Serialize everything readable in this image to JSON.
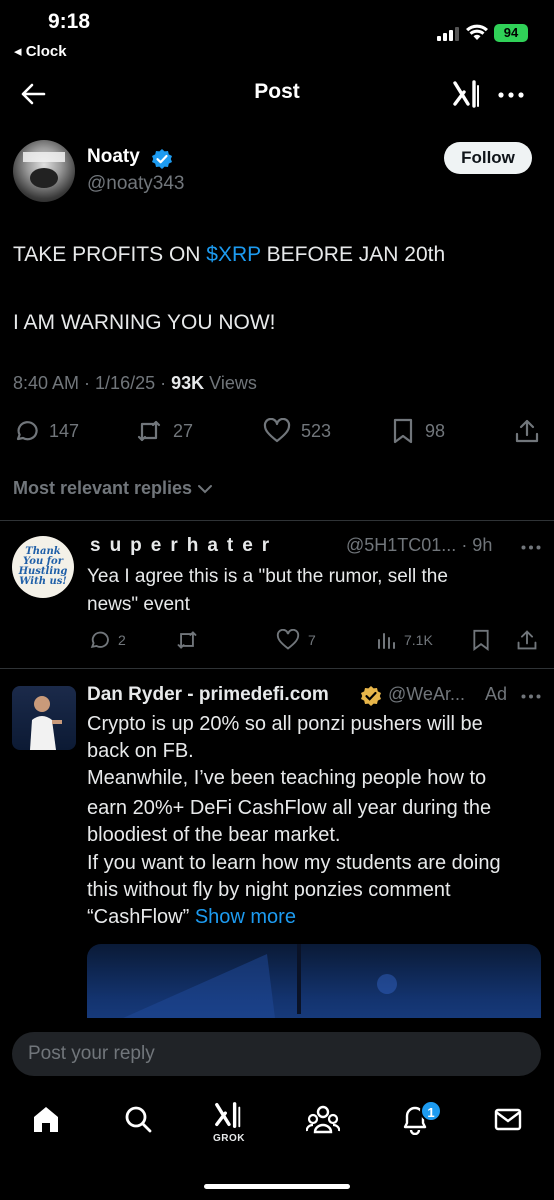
{
  "status_bar": {
    "time": "9:18",
    "back_app": "◂ Clock",
    "battery": "94"
  },
  "header": {
    "title": "Post"
  },
  "post": {
    "author_name": "Noaty",
    "author_handle": "@noaty343",
    "follow_label": "Follow",
    "text_line1_before": "TAKE PROFITS ON ",
    "text_line1_cashtag": "$XRP",
    "text_line1_after": " BEFORE JAN 20th",
    "text_line2": "I AM WARNING YOU NOW!",
    "time": "8:40 AM",
    "date": "1/16/25",
    "views_count": "93K",
    "views_label": "Views",
    "replies": "147",
    "reposts": "27",
    "likes": "523",
    "bookmarks": "98"
  },
  "replies_filter": "Most relevant replies",
  "reply": {
    "avatar_text": "Thank You for Hustling With us!",
    "name": "superhater",
    "handle_time": "@5H1TC01... · 9h",
    "text_line1": "Yea I agree this is a \"but the rumor, sell the",
    "text_line2": "news\" event",
    "replies": "2",
    "likes": "7",
    "views": "7.1K"
  },
  "ad": {
    "name": "Dan Ryder - primedefi.com",
    "handle": "@WeAr...",
    "ad_label": "Ad",
    "lines": [
      "Crypto is up 20% so all ponzi pushers will be",
      "back on FB.",
      "Meanwhile, I’ve been teaching people how to",
      "earn 20%+ DeFi CashFlow all year during the",
      "bloodiest of the bear market.",
      "If you want to learn how my students are doing",
      "this without fly by night ponzies comment"
    ],
    "last_line": "“CashFlow”",
    "show_more": "Show more"
  },
  "reply_box": {
    "placeholder": "Post your reply"
  },
  "nav": {
    "grok_label": "GROK",
    "notification_count": "1"
  },
  "colors": {
    "accent": "#1d9bf0",
    "background": "#000000",
    "muted": "#71767b",
    "verified": "#1d9bf0",
    "gold": "#e8b64a"
  }
}
